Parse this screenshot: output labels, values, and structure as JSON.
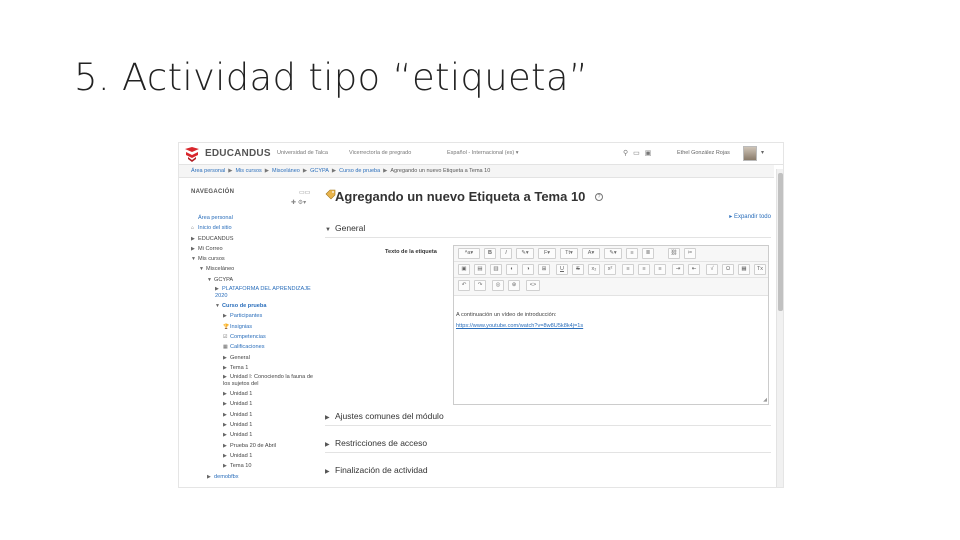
{
  "slide": {
    "title": "5. Actividad tipo “etiqueta”"
  },
  "navbar": {
    "brand": "EDUCANDUS",
    "links": [
      "Universidad de Talca",
      "Vicerrectoría de pregrado",
      "Español - Internacional (es) ▾"
    ],
    "user": "Ethel González Rojas",
    "icons": [
      "search-icon",
      "chat-icon",
      "message-icon"
    ]
  },
  "breadcrumb": {
    "items": [
      "Área personal",
      "Mis cursos",
      "Misceláneo",
      "GCYPA",
      "Curso de prueba"
    ],
    "current": "Agregando un nuevo Etiqueta a Tema 10"
  },
  "sidebar": {
    "title": "NAVEGACIÓN",
    "items": [
      {
        "label": "Área personal",
        "indent": 0,
        "arrow": "",
        "style": "link"
      },
      {
        "label": "Inicio del sitio",
        "indent": 0,
        "arrow": "⌂",
        "style": "link"
      },
      {
        "label": "EDUCANDUS",
        "indent": 0,
        "arrow": "▶",
        "style": "dark"
      },
      {
        "label": "Mi Correo",
        "indent": 0,
        "arrow": "▶",
        "style": "dark"
      },
      {
        "label": "Mis cursos",
        "indent": 0,
        "arrow": "▼",
        "style": "dark"
      },
      {
        "label": "Misceláneo",
        "indent": 1,
        "arrow": "▼",
        "style": "dark"
      },
      {
        "label": "GCYPA",
        "indent": 2,
        "arrow": "▼",
        "style": "dark"
      },
      {
        "label": "PLATAFORMA DEL APRENDIZAJE 2020",
        "indent": 3,
        "arrow": "▶",
        "style": "link wrap"
      },
      {
        "label": "Curso de prueba",
        "indent": 3,
        "arrow": "▼",
        "style": "link bold"
      },
      {
        "label": "Participantes",
        "indent": 4,
        "arrow": "▶",
        "style": "link"
      },
      {
        "label": "Insignias",
        "indent": 4,
        "arrow": "🏆",
        "style": "link"
      },
      {
        "label": "Competencias",
        "indent": 4,
        "arrow": "☑",
        "style": "link"
      },
      {
        "label": "Calificaciones",
        "indent": 4,
        "arrow": "▦",
        "style": "link"
      },
      {
        "label": "General",
        "indent": 4,
        "arrow": "▶",
        "style": "dark"
      },
      {
        "label": "Tema 1",
        "indent": 4,
        "arrow": "▶",
        "style": "dark"
      },
      {
        "label": "Unidad I: Conociendo la fauna de los sujetos del",
        "indent": 4,
        "arrow": "▶",
        "style": "dark wrap"
      },
      {
        "label": "Unidad 1",
        "indent": 4,
        "arrow": "▶",
        "style": "dark"
      },
      {
        "label": "Unidad 1",
        "indent": 4,
        "arrow": "▶",
        "style": "dark"
      },
      {
        "label": "Unidad 1",
        "indent": 4,
        "arrow": "▶",
        "style": "dark"
      },
      {
        "label": "Unidad 1",
        "indent": 4,
        "arrow": "▶",
        "style": "dark"
      },
      {
        "label": "Unidad 1",
        "indent": 4,
        "arrow": "▶",
        "style": "dark"
      },
      {
        "label": "Prueba 20 de Abril",
        "indent": 4,
        "arrow": "▶",
        "style": "dark"
      },
      {
        "label": "Unidad 1",
        "indent": 4,
        "arrow": "▶",
        "style": "dark"
      },
      {
        "label": "Tema 10",
        "indent": 4,
        "arrow": "▶",
        "style": "dark"
      },
      {
        "label": "demobfbx",
        "indent": 2,
        "arrow": "▶",
        "style": "link"
      }
    ]
  },
  "main": {
    "heading": "Agregando un nuevo Etiqueta a Tema 10",
    "expand_all": "▸ Expandir todo",
    "sections": {
      "general": "General",
      "ajustes": "Ajustes comunes del módulo",
      "restricciones": "Restricciones de acceso",
      "finalizacion": "Finalización de actividad"
    },
    "field_label": "Texto de la etiqueta",
    "editor": {
      "line1": "A continuación un vídeo de introducción:",
      "line2": "https://www.youtube.com/watch?v=8w8U5k8k4j=1s"
    }
  },
  "colors": {
    "link": "#2a6ebb",
    "brand": "#d9262c"
  }
}
